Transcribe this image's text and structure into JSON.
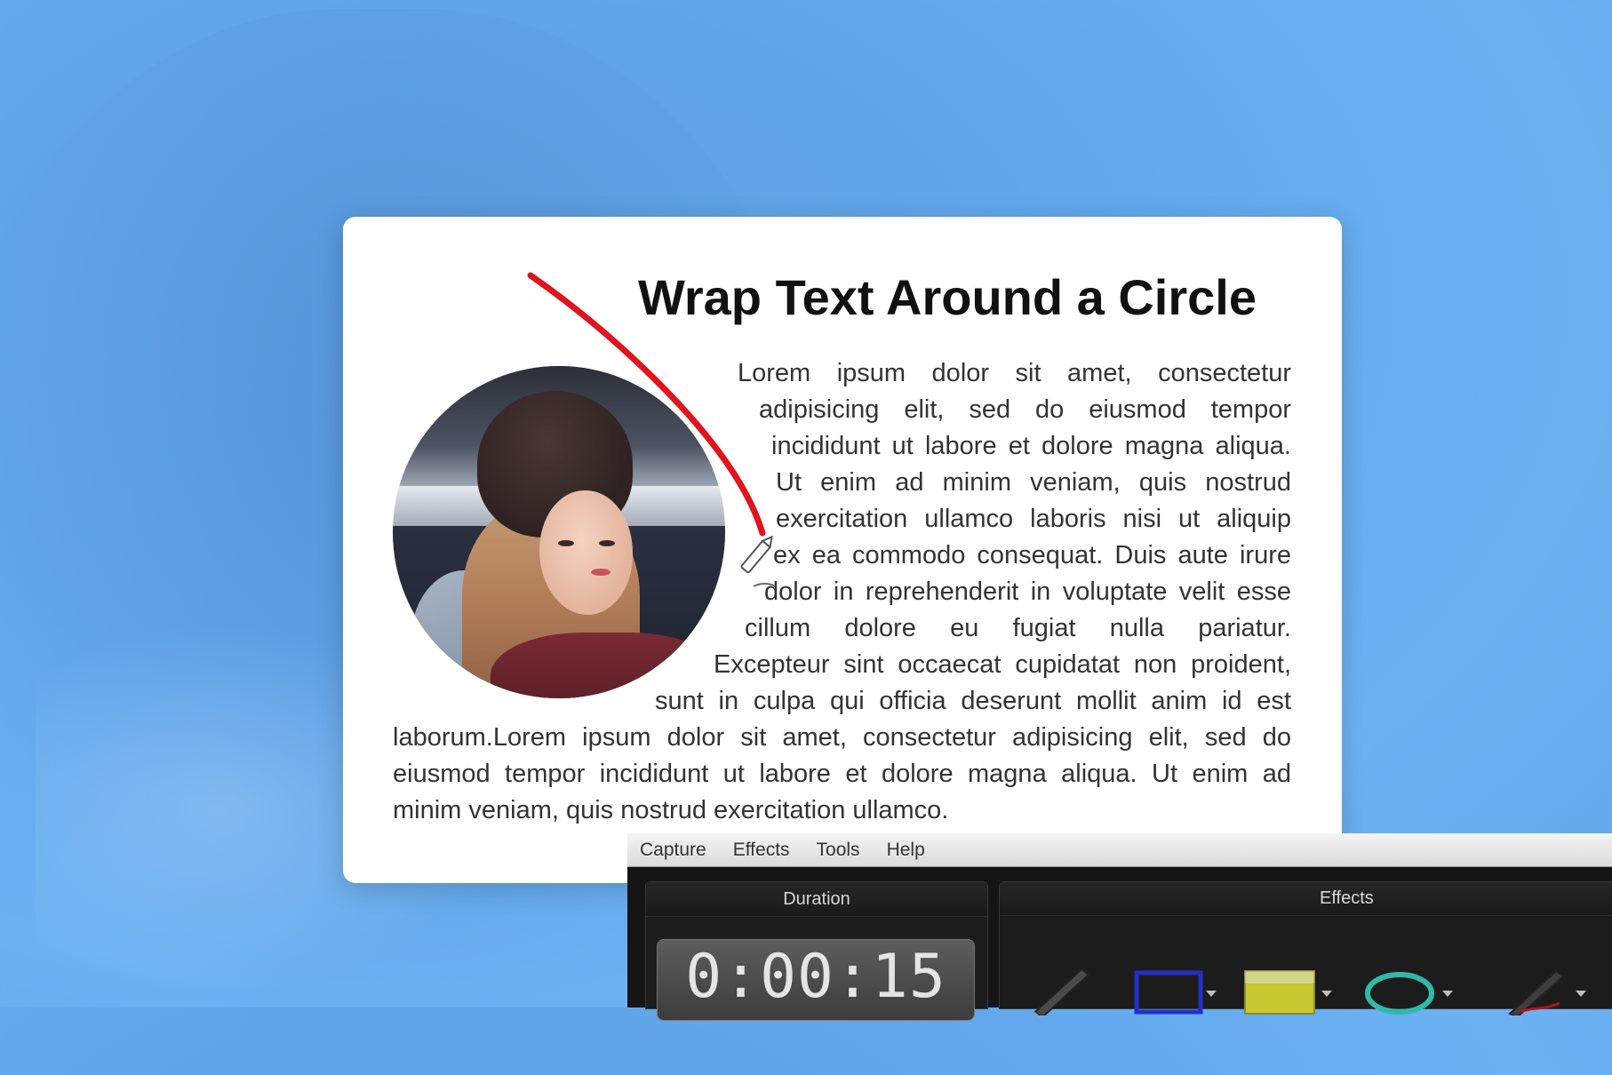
{
  "document": {
    "title": "Wrap Text Around a Circle",
    "paragraph_lines": [
      "Lorem ipsum dolor sit amet, consectetur",
      "adipisicing elit, sed do eiusmod tempor",
      "incididunt ut labore et dolore magna aliqua.",
      "Ut enim ad minim veniam, quis nostrud",
      "exercitation ullamco laboris nisi ut aliquip",
      "ex ea commodo consequat. Duis aute irure",
      "dolor in reprehenderit in voluptate velit esse",
      "cillum dolore eu fugiat nulla pariatur.",
      "Excepteur sint occaecat cupidatat non proident,",
      "sunt in culpa qui officia deserunt mollit anim id est",
      "laborum.Lorem ipsum dolor sit amet, consectetur adipisicing elit, sed do",
      "eiusmod tempor incididunt ut labore et dolore magna aliqua. Ut enim ad",
      "minim veniam, quis nostrud exercitation ullamco."
    ]
  },
  "annotation": {
    "stroke_color": "#e0141e"
  },
  "recorder": {
    "menu": [
      "Capture",
      "Effects",
      "Tools",
      "Help"
    ],
    "duration_label": "Duration",
    "duration_value": "0:00:15",
    "effects_label": "Effects",
    "tools": [
      "pen-icon",
      "rectangle-icon",
      "highlight-icon",
      "ellipse-icon",
      "pen-color-icon"
    ],
    "colors": {
      "rectangle": "#2330c8",
      "highlight": "#c8c832",
      "ellipse": "#2fb9a8"
    }
  }
}
